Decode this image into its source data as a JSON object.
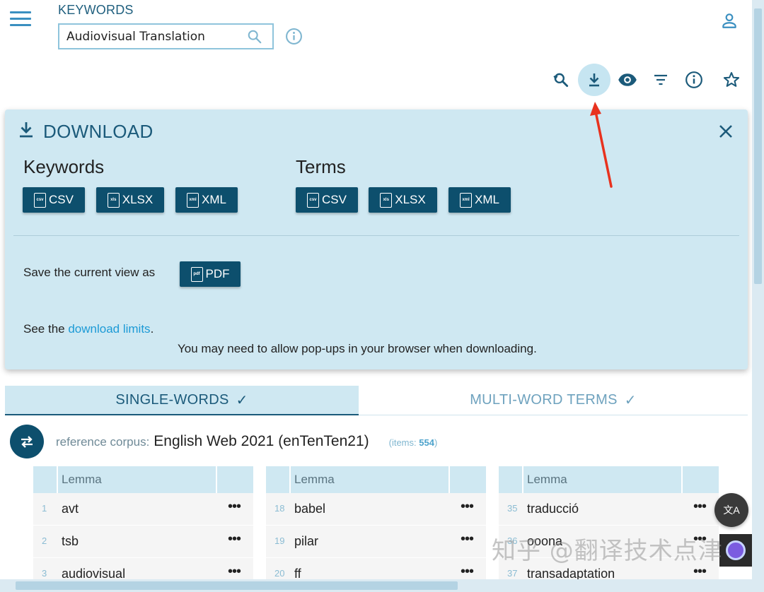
{
  "header": {
    "keywords_label": "KEYWORDS",
    "search_value": "Audiovisual Translation"
  },
  "toolbar": {
    "icons": [
      "search-history-icon",
      "download-icon",
      "eye-icon",
      "filter-icon",
      "info-icon",
      "star-icon"
    ],
    "active": "download-icon"
  },
  "download": {
    "title": "DOWNLOAD",
    "keywords_heading": "Keywords",
    "terms_heading": "Terms",
    "keywords_buttons": [
      "CSV",
      "XLSX",
      "XML"
    ],
    "terms_buttons": [
      "CSV",
      "XLSX",
      "XML"
    ],
    "file_icon_tags": [
      "csv",
      "xls",
      "xml",
      "pdf"
    ],
    "save_text": "Save the current view as",
    "pdf_label": "PDF",
    "limits_prefix": "See the ",
    "limits_link": "download limits",
    "limits_suffix": ".",
    "popups_note": "You may need to allow pop-ups in your browser when downloading."
  },
  "tabs": {
    "single": "SINGLE-WORDS",
    "multi": "MULTI-WORD TERMS",
    "check": "✓"
  },
  "reference": {
    "label": "reference corpus:",
    "corpus": "English Web 2021 (enTenTen21)",
    "items_label": "(items: ",
    "items_count": "554",
    "items_close": ")"
  },
  "tables": [
    {
      "header": "Lemma",
      "rows": [
        {
          "n": "1",
          "w": "avt"
        },
        {
          "n": "2",
          "w": "tsb"
        },
        {
          "n": "3",
          "w": "audiovisual"
        }
      ]
    },
    {
      "header": "Lemma",
      "rows": [
        {
          "n": "18",
          "w": "babel"
        },
        {
          "n": "19",
          "w": "pilar"
        },
        {
          "n": "20",
          "w": "ff"
        }
      ]
    },
    {
      "header": "Lemma",
      "rows": [
        {
          "n": "35",
          "w": "traducció"
        },
        {
          "n": "36",
          "w": "ooona"
        },
        {
          "n": "37",
          "w": "transadaptation"
        }
      ]
    }
  ],
  "row_menu": "•••",
  "fab": {
    "translate_glyph": "文A"
  },
  "watermark": "知乎 @翻译技术点津",
  "colors": {
    "primary": "#0d4f6d",
    "panel_bg": "#cfe8f2",
    "accent_link": "#1c9ad6",
    "annotation_arrow": "#e8321e"
  }
}
